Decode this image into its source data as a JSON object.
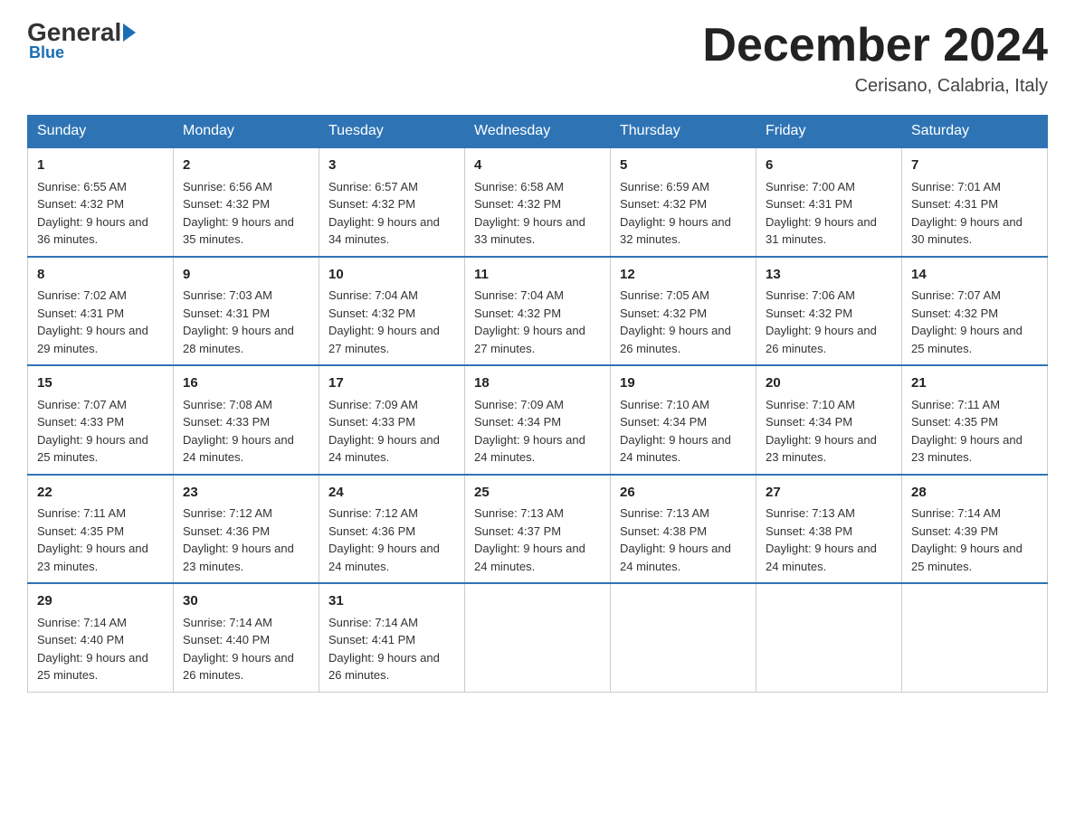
{
  "header": {
    "logo_text": "General",
    "logo_blue": "Blue",
    "month_title": "December 2024",
    "location": "Cerisano, Calabria, Italy"
  },
  "days_of_week": [
    "Sunday",
    "Monday",
    "Tuesday",
    "Wednesday",
    "Thursday",
    "Friday",
    "Saturday"
  ],
  "weeks": [
    [
      {
        "day": "1",
        "sunrise": "6:55 AM",
        "sunset": "4:32 PM",
        "daylight": "9 hours and 36 minutes."
      },
      {
        "day": "2",
        "sunrise": "6:56 AM",
        "sunset": "4:32 PM",
        "daylight": "9 hours and 35 minutes."
      },
      {
        "day": "3",
        "sunrise": "6:57 AM",
        "sunset": "4:32 PM",
        "daylight": "9 hours and 34 minutes."
      },
      {
        "day": "4",
        "sunrise": "6:58 AM",
        "sunset": "4:32 PM",
        "daylight": "9 hours and 33 minutes."
      },
      {
        "day": "5",
        "sunrise": "6:59 AM",
        "sunset": "4:32 PM",
        "daylight": "9 hours and 32 minutes."
      },
      {
        "day": "6",
        "sunrise": "7:00 AM",
        "sunset": "4:31 PM",
        "daylight": "9 hours and 31 minutes."
      },
      {
        "day": "7",
        "sunrise": "7:01 AM",
        "sunset": "4:31 PM",
        "daylight": "9 hours and 30 minutes."
      }
    ],
    [
      {
        "day": "8",
        "sunrise": "7:02 AM",
        "sunset": "4:31 PM",
        "daylight": "9 hours and 29 minutes."
      },
      {
        "day": "9",
        "sunrise": "7:03 AM",
        "sunset": "4:31 PM",
        "daylight": "9 hours and 28 minutes."
      },
      {
        "day": "10",
        "sunrise": "7:04 AM",
        "sunset": "4:32 PM",
        "daylight": "9 hours and 27 minutes."
      },
      {
        "day": "11",
        "sunrise": "7:04 AM",
        "sunset": "4:32 PM",
        "daylight": "9 hours and 27 minutes."
      },
      {
        "day": "12",
        "sunrise": "7:05 AM",
        "sunset": "4:32 PM",
        "daylight": "9 hours and 26 minutes."
      },
      {
        "day": "13",
        "sunrise": "7:06 AM",
        "sunset": "4:32 PM",
        "daylight": "9 hours and 26 minutes."
      },
      {
        "day": "14",
        "sunrise": "7:07 AM",
        "sunset": "4:32 PM",
        "daylight": "9 hours and 25 minutes."
      }
    ],
    [
      {
        "day": "15",
        "sunrise": "7:07 AM",
        "sunset": "4:33 PM",
        "daylight": "9 hours and 25 minutes."
      },
      {
        "day": "16",
        "sunrise": "7:08 AM",
        "sunset": "4:33 PM",
        "daylight": "9 hours and 24 minutes."
      },
      {
        "day": "17",
        "sunrise": "7:09 AM",
        "sunset": "4:33 PM",
        "daylight": "9 hours and 24 minutes."
      },
      {
        "day": "18",
        "sunrise": "7:09 AM",
        "sunset": "4:34 PM",
        "daylight": "9 hours and 24 minutes."
      },
      {
        "day": "19",
        "sunrise": "7:10 AM",
        "sunset": "4:34 PM",
        "daylight": "9 hours and 24 minutes."
      },
      {
        "day": "20",
        "sunrise": "7:10 AM",
        "sunset": "4:34 PM",
        "daylight": "9 hours and 23 minutes."
      },
      {
        "day": "21",
        "sunrise": "7:11 AM",
        "sunset": "4:35 PM",
        "daylight": "9 hours and 23 minutes."
      }
    ],
    [
      {
        "day": "22",
        "sunrise": "7:11 AM",
        "sunset": "4:35 PM",
        "daylight": "9 hours and 23 minutes."
      },
      {
        "day": "23",
        "sunrise": "7:12 AM",
        "sunset": "4:36 PM",
        "daylight": "9 hours and 23 minutes."
      },
      {
        "day": "24",
        "sunrise": "7:12 AM",
        "sunset": "4:36 PM",
        "daylight": "9 hours and 24 minutes."
      },
      {
        "day": "25",
        "sunrise": "7:13 AM",
        "sunset": "4:37 PM",
        "daylight": "9 hours and 24 minutes."
      },
      {
        "day": "26",
        "sunrise": "7:13 AM",
        "sunset": "4:38 PM",
        "daylight": "9 hours and 24 minutes."
      },
      {
        "day": "27",
        "sunrise": "7:13 AM",
        "sunset": "4:38 PM",
        "daylight": "9 hours and 24 minutes."
      },
      {
        "day": "28",
        "sunrise": "7:14 AM",
        "sunset": "4:39 PM",
        "daylight": "9 hours and 25 minutes."
      }
    ],
    [
      {
        "day": "29",
        "sunrise": "7:14 AM",
        "sunset": "4:40 PM",
        "daylight": "9 hours and 25 minutes."
      },
      {
        "day": "30",
        "sunrise": "7:14 AM",
        "sunset": "4:40 PM",
        "daylight": "9 hours and 26 minutes."
      },
      {
        "day": "31",
        "sunrise": "7:14 AM",
        "sunset": "4:41 PM",
        "daylight": "9 hours and 26 minutes."
      },
      null,
      null,
      null,
      null
    ]
  ]
}
